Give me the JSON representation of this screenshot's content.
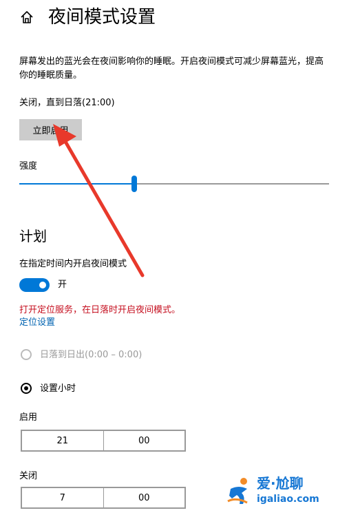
{
  "header": {
    "title": "夜间模式设置"
  },
  "intro": {
    "description": "屏幕发出的蓝光会在夜间影响你的睡眠。开启夜间模式可减少屏幕蓝光，提高你的睡眠质量。"
  },
  "status": {
    "text": "关闭，直到日落(21:00)"
  },
  "enable_button": {
    "label": "立即启用"
  },
  "strength": {
    "label": "强度",
    "value_fraction": 0.37
  },
  "schedule": {
    "heading": "计划",
    "toggle_label": "在指定时间内开启夜间模式",
    "toggle_state": "开",
    "warning": "打开定位服务，在日落时开启夜间模式。",
    "location_link": "定位设置",
    "options": [
      {
        "label": "日落到日出(0:00 – 0:00)",
        "selected": false,
        "disabled": true
      },
      {
        "label": "设置小时",
        "selected": true,
        "disabled": false
      }
    ],
    "turn_on": {
      "label": "启用",
      "hour": "21",
      "minute": "00"
    },
    "turn_off": {
      "label": "关闭",
      "hour": "7",
      "minute": "00"
    }
  },
  "watermark": {
    "title": "爱·尬聊",
    "url": "igaliao.com"
  },
  "colors": {
    "accent": "#0078d7",
    "warning": "#c50f1f",
    "link": "#0063b1",
    "arrow": "#e8392b",
    "watermark": "#1677d4"
  }
}
